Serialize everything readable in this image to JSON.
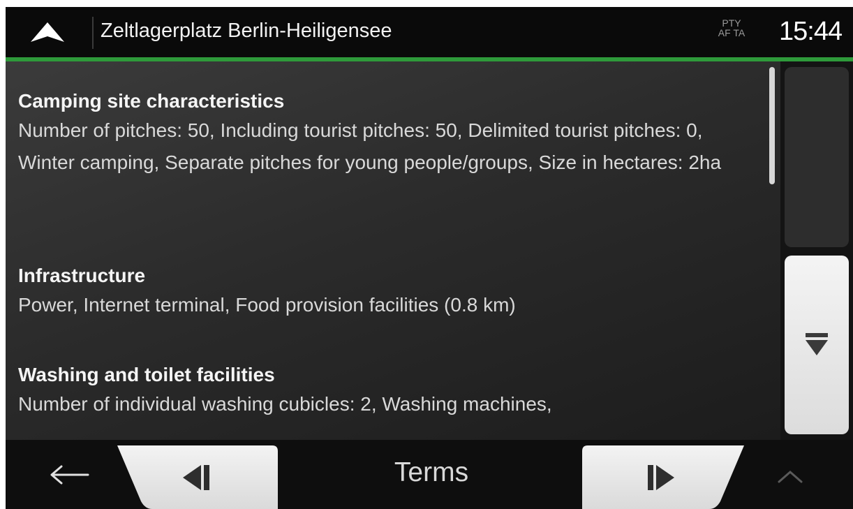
{
  "header": {
    "title": "Zeltlagerplatz Berlin-Heiligensee",
    "radio_flags_top": "PTY",
    "radio_flags_bottom": "AF TA",
    "clock": "15:44",
    "accent_color": "#2e9a3a"
  },
  "sections": [
    {
      "title": "Camping site characteristics",
      "body": "Number of pitches: 50, Including tourist pitches: 50, Delimited tourist pitches: 0, Winter camping, Separate pitches for young people/groups, Size in hectares: 2ha"
    },
    {
      "title": "Infrastructure",
      "body": "Power, Internet terminal, Food provision facilities (0.8 km)"
    },
    {
      "title": "Washing and toilet facilities",
      "body": "Number of individual washing cubicles: 2, Washing machines,"
    }
  ],
  "bottom_bar": {
    "label": "Terms"
  },
  "icons": {
    "nav_arrow": "navigation-arrow-icon",
    "back": "back-arrow-icon",
    "prev": "previous-page-icon",
    "next": "next-page-icon",
    "scroll_down": "scroll-down-icon",
    "collapse": "chevron-up-icon"
  }
}
